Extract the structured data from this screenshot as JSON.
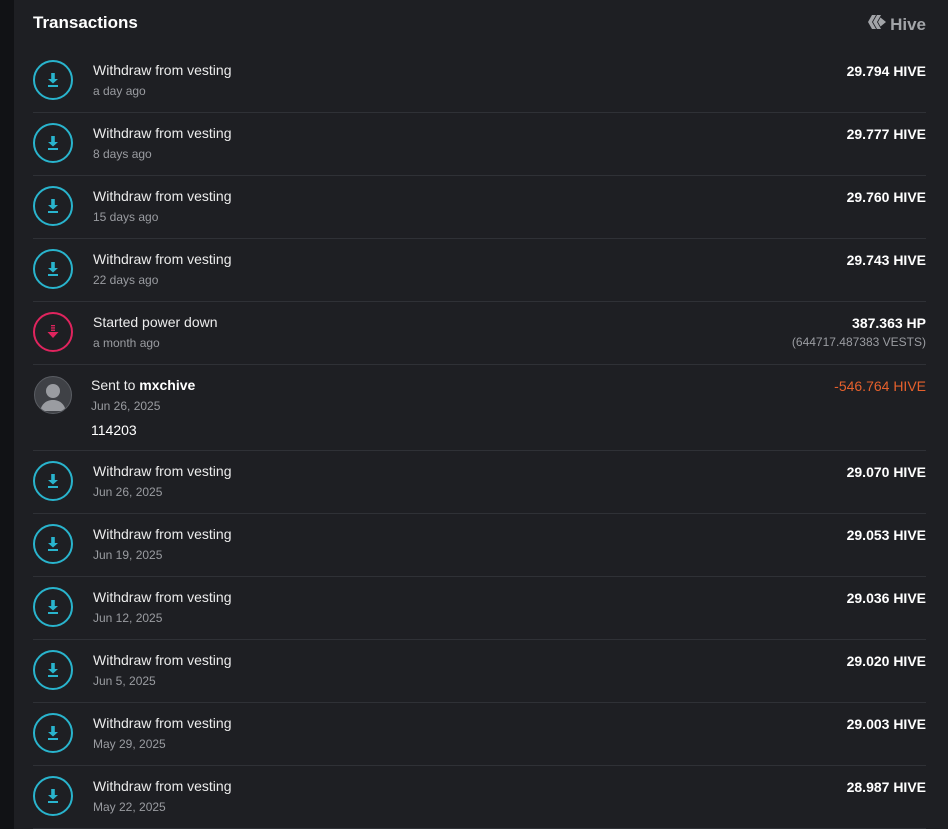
{
  "header": {
    "title": "Transactions",
    "brand": "Hive"
  },
  "transactions": [
    {
      "title": "Withdraw from vesting",
      "time": "a day ago",
      "amount": "29.794 HIVE"
    },
    {
      "title": "Withdraw from vesting",
      "time": "8 days ago",
      "amount": "29.777 HIVE"
    },
    {
      "title": "Withdraw from vesting",
      "time": "15 days ago",
      "amount": "29.760 HIVE"
    },
    {
      "title": "Withdraw from vesting",
      "time": "22 days ago",
      "amount": "29.743 HIVE"
    },
    {
      "title": "Started power down",
      "time": "a month ago",
      "amount": "387.363 HP",
      "sub_amount": "(644717.487383 VESTS)"
    },
    {
      "title_prefix": "Sent to ",
      "recipient": "mxchive",
      "time": "Jun 26, 2025",
      "memo": "114203",
      "amount": "-546.764 HIVE"
    },
    {
      "title": "Withdraw from vesting",
      "time": "Jun 26, 2025",
      "amount": "29.070 HIVE"
    },
    {
      "title": "Withdraw from vesting",
      "time": "Jun 19, 2025",
      "amount": "29.053 HIVE"
    },
    {
      "title": "Withdraw from vesting",
      "time": "Jun 12, 2025",
      "amount": "29.036 HIVE"
    },
    {
      "title": "Withdraw from vesting",
      "time": "Jun 5, 2025",
      "amount": "29.020 HIVE"
    },
    {
      "title": "Withdraw from vesting",
      "time": "May 29, 2025",
      "amount": "29.003 HIVE"
    },
    {
      "title": "Withdraw from vesting",
      "time": "May 22, 2025",
      "amount": "28.987 HIVE"
    }
  ],
  "colors": {
    "accent": "#29b4cd",
    "power_down": "#e0245e",
    "negative": "#e6602c",
    "panel_bg": "#1e1f23"
  },
  "icons": {
    "withdraw": "download-icon",
    "power_down": "power-down-icon",
    "sent": "avatar",
    "brand": "hive-logo-icon"
  }
}
